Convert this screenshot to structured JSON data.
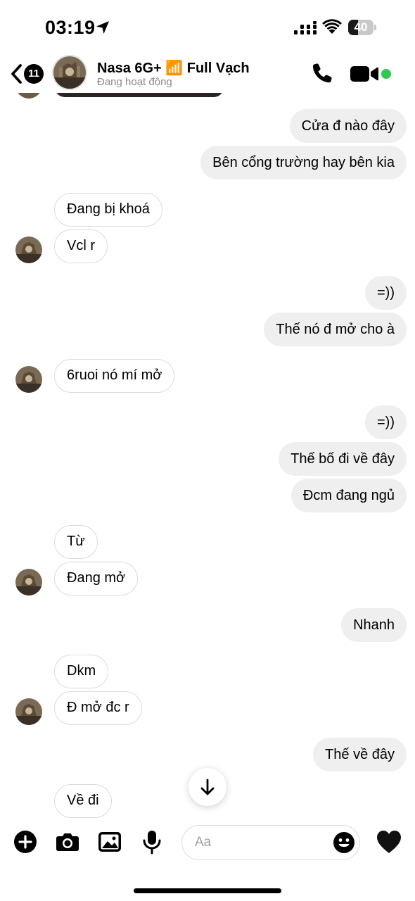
{
  "status_bar": {
    "time": "03:19",
    "battery_level": "40",
    "battery_fraction": 0.4
  },
  "header": {
    "unread_count": "11",
    "contact_name": "Nasa 6G+ 📶 Full Vạch",
    "contact_status": "Đang hoạt động",
    "online": true
  },
  "messages": [
    {
      "side": "out",
      "text": "Cửa đ nào đây"
    },
    {
      "side": "out",
      "text": "Bên cổng trường hay bên kia"
    },
    {
      "side": "in",
      "text": "Đang bị khoá"
    },
    {
      "side": "in",
      "text": "Vcl r"
    },
    {
      "side": "out",
      "text": "=))"
    },
    {
      "side": "out",
      "text": "Thế nó đ mở cho à"
    },
    {
      "side": "in",
      "text": "6ruoi nó mí mở"
    },
    {
      "side": "out",
      "text": "=))"
    },
    {
      "side": "out",
      "text": "Thế bố đi về đây"
    },
    {
      "side": "out",
      "text": "Đcm đang ngủ"
    },
    {
      "side": "in",
      "text": "Từ"
    },
    {
      "side": "in",
      "text": "Đang mở"
    },
    {
      "side": "out",
      "text": "Nhanh"
    },
    {
      "side": "in",
      "text": "Dkm"
    },
    {
      "side": "in",
      "text": "Đ mở đc r"
    },
    {
      "side": "out",
      "text": "Thế về đây"
    },
    {
      "side": "in",
      "text": "Về đi"
    }
  ],
  "composer": {
    "placeholder": "Aa"
  },
  "icons": {
    "add": "plus-circle-icon",
    "camera": "camera-icon",
    "gallery": "image-icon",
    "voice": "microphone-icon",
    "emoji": "smiley-icon",
    "like": "black-heart-icon",
    "call": "phone-icon",
    "video": "video-camera-icon",
    "scroll": "arrow-down-icon"
  },
  "colors": {
    "outgoing_bubble": "#efefef",
    "incoming_border": "#dcdcdc",
    "online_green": "#31c950",
    "secondary_text": "#8a8a8a"
  }
}
